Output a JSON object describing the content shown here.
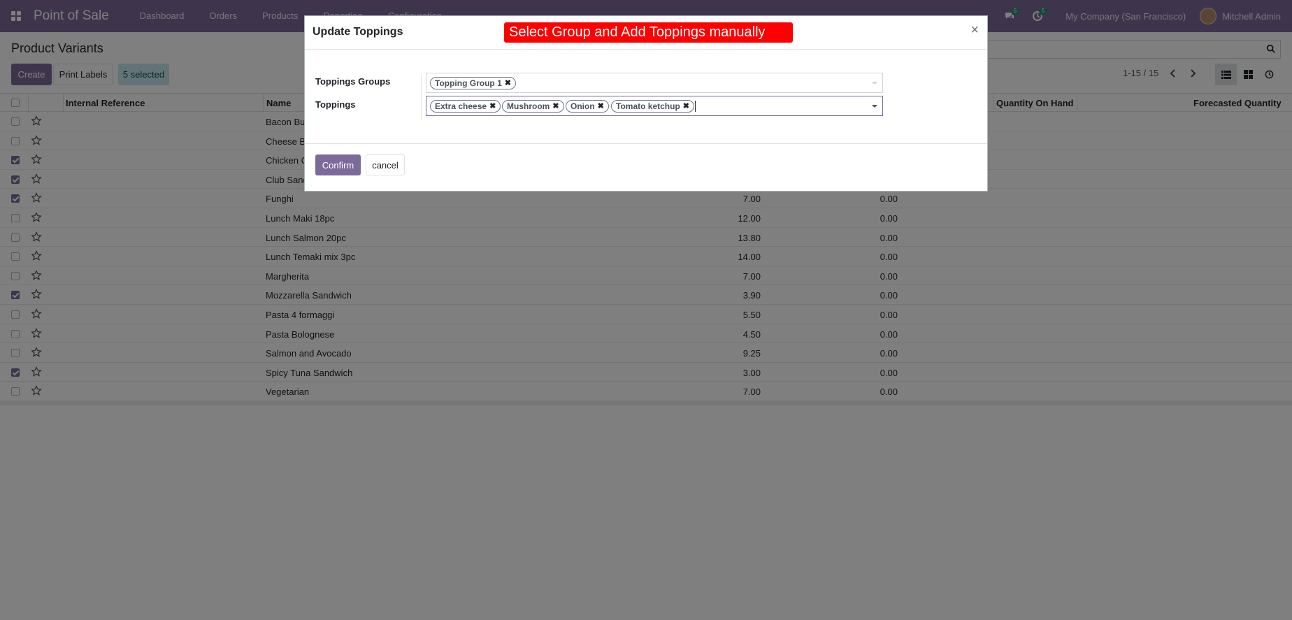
{
  "navbar": {
    "app_name": "Point of Sale",
    "menu": [
      "Dashboard",
      "Orders",
      "Products",
      "Reporting",
      "Configuration"
    ],
    "messages_count": "5",
    "activities_count": "5",
    "company": "My Company (San Francisco)",
    "user": "Mitchell Admin"
  },
  "control_panel": {
    "title": "Product Variants",
    "create_label": "Create",
    "print_labels_label": "Print Labels",
    "selected_label": "5 selected",
    "pager": "1-15 / 15"
  },
  "table": {
    "headers": {
      "internal_reference": "Internal Reference",
      "name": "Name",
      "quantity_on_hand": "Quantity On Hand",
      "forecasted_quantity": "Forecasted Quantity"
    },
    "rows": [
      {
        "name": "Bacon Burger",
        "price": "",
        "cost": "",
        "checked": false
      },
      {
        "name": "Cheese Burger",
        "price": "",
        "cost": "",
        "checked": false
      },
      {
        "name": "Chicken Curry Sandwich",
        "price": "",
        "cost": "",
        "checked": true
      },
      {
        "name": "Club Sandwich",
        "price": "",
        "cost": "",
        "checked": true
      },
      {
        "name": "Funghi",
        "price": "7.00",
        "cost": "0.00",
        "checked": true
      },
      {
        "name": "Lunch Maki 18pc",
        "price": "12.00",
        "cost": "0.00",
        "checked": false
      },
      {
        "name": "Lunch Salmon 20pc",
        "price": "13.80",
        "cost": "0.00",
        "checked": false
      },
      {
        "name": "Lunch Temaki mix 3pc",
        "price": "14.00",
        "cost": "0.00",
        "checked": false
      },
      {
        "name": "Margherita",
        "price": "7.00",
        "cost": "0.00",
        "checked": false
      },
      {
        "name": "Mozzarella Sandwich",
        "price": "3.90",
        "cost": "0.00",
        "checked": true
      },
      {
        "name": "Pasta 4 formaggi",
        "price": "5.50",
        "cost": "0.00",
        "checked": false
      },
      {
        "name": "Pasta Bolognese",
        "price": "4.50",
        "cost": "0.00",
        "checked": false
      },
      {
        "name": "Salmon and Avocado",
        "price": "9.25",
        "cost": "0.00",
        "checked": false
      },
      {
        "name": "Spicy Tuna Sandwich",
        "price": "3.00",
        "cost": "0.00",
        "checked": true
      },
      {
        "name": "Vegetarian",
        "price": "7.00",
        "cost": "0.00",
        "checked": false
      }
    ]
  },
  "modal": {
    "title": "Update Toppings",
    "annotation": "Select Group and Add Toppings manually",
    "close_symbol": "×",
    "groups_label": "Toppings Groups",
    "groups_tags": [
      "Topping Group 1"
    ],
    "toppings_label": "Toppings",
    "toppings_tags": [
      "Extra cheese",
      "Mushroom",
      "Onion",
      "Tomato ketchup"
    ],
    "confirm_label": "Confirm",
    "cancel_label": "cancel"
  },
  "colors": {
    "brand": "#7c6b9a",
    "annotation": "#ff0000"
  }
}
